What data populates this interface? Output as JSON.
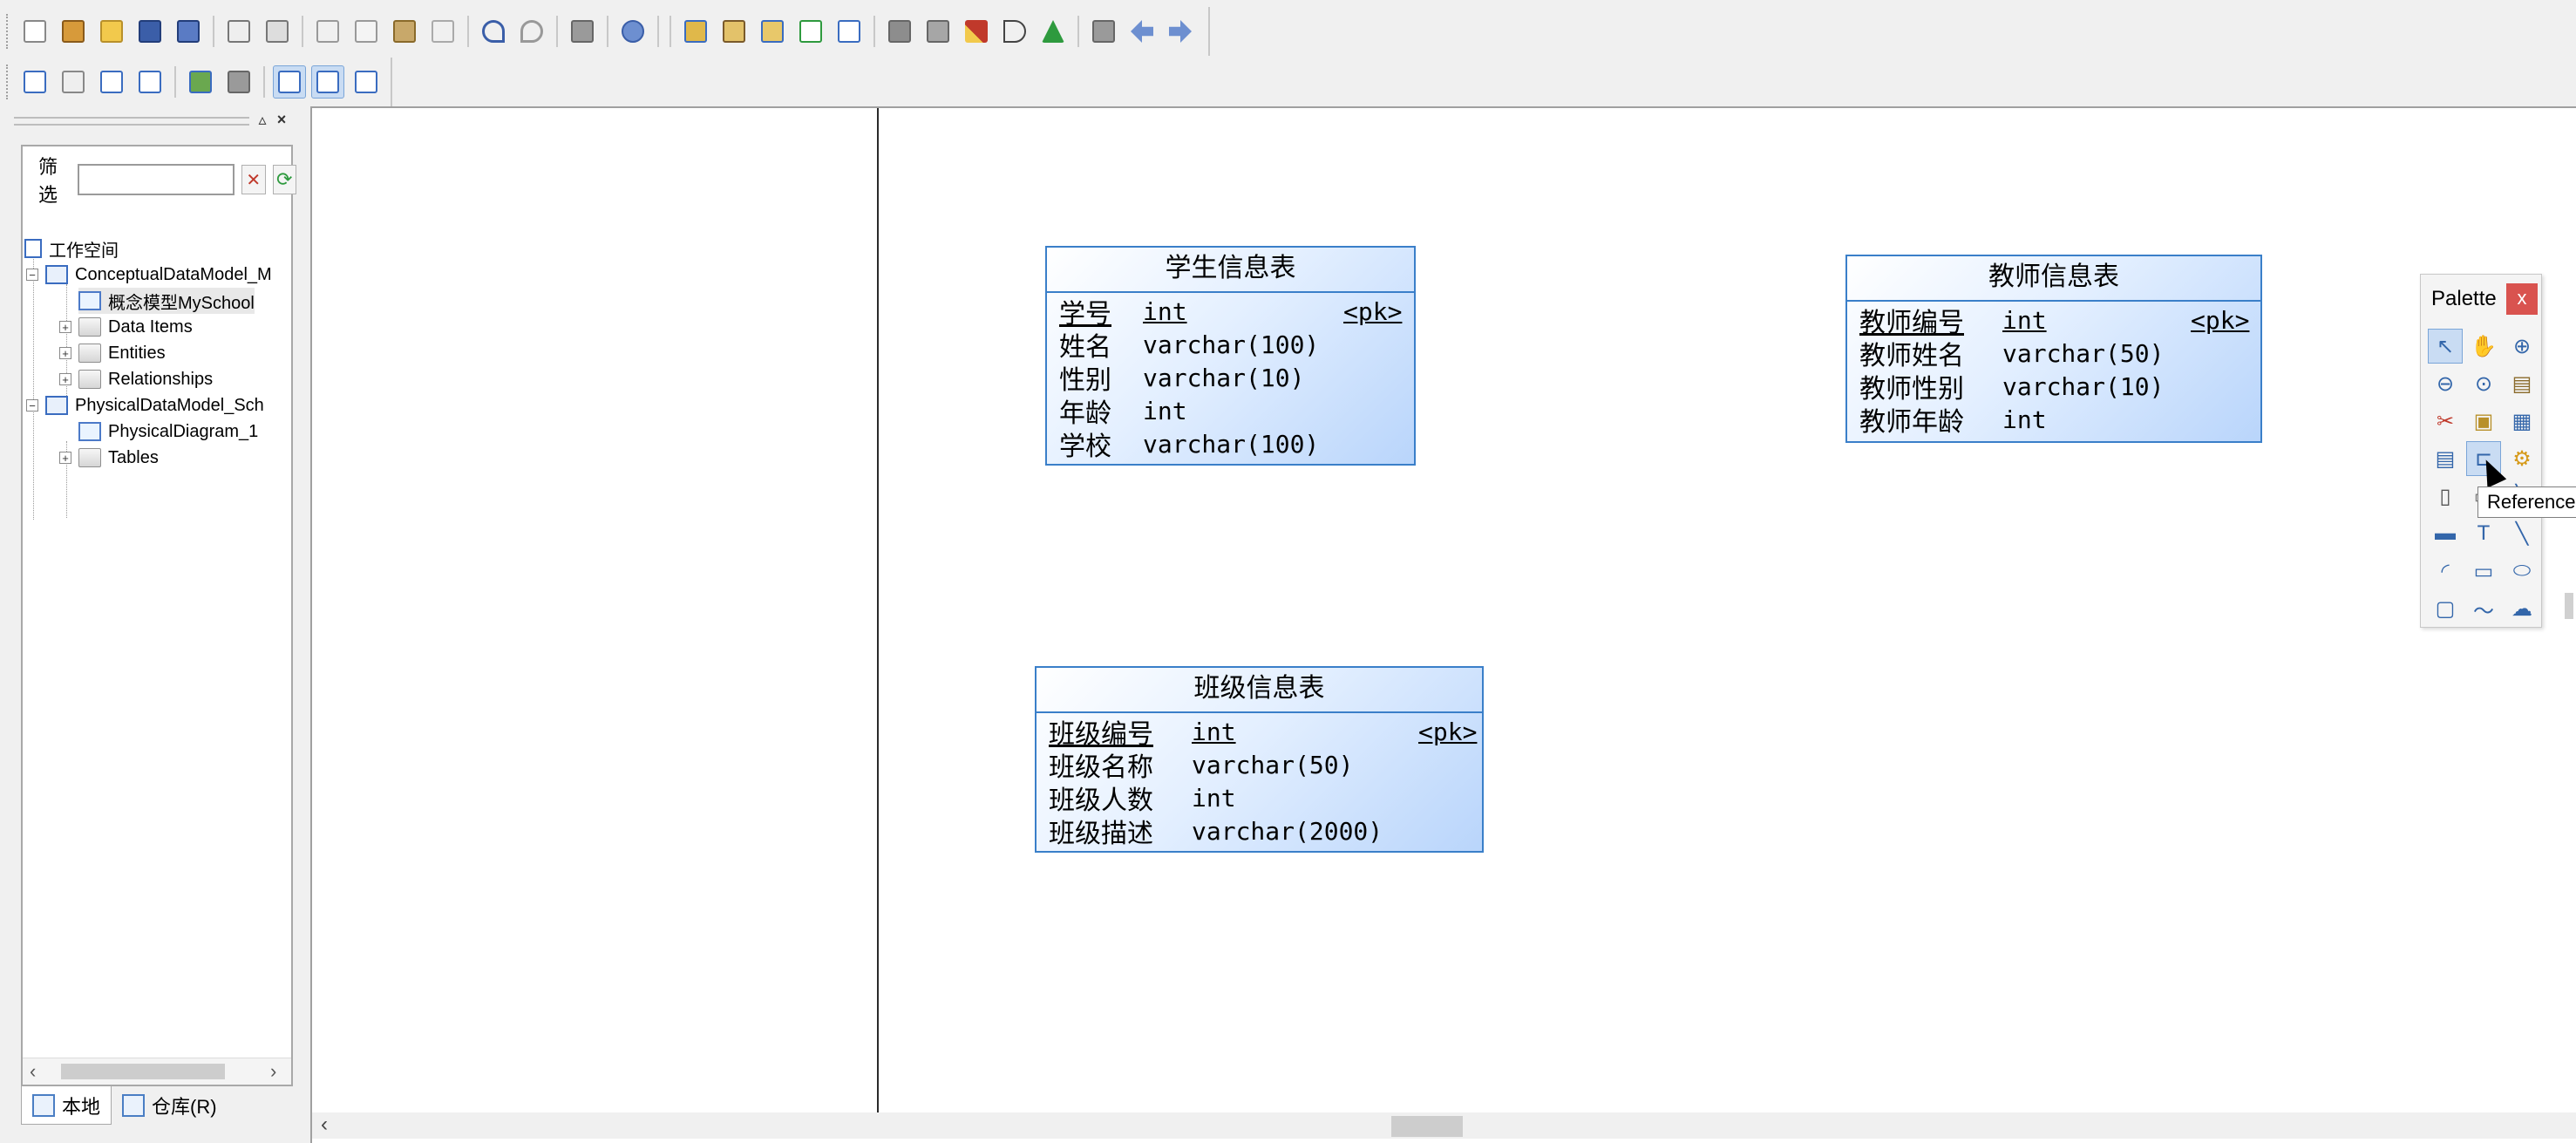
{
  "browser": {
    "filter_label": "筛选",
    "filter_value": "",
    "tree": {
      "workspace": "工作空间",
      "conceptual_model": "ConceptualDataModel_M",
      "conceptual_diagram": "概念模型MySchool",
      "data_items": "Data Items",
      "entities": "Entities",
      "relationships": "Relationships",
      "physical_model": "PhysicalDataModel_Sch",
      "physical_diagram": "PhysicalDiagram_1",
      "tables": "Tables"
    },
    "tabs": [
      {
        "label": "本地"
      },
      {
        "label": "仓库(R)"
      }
    ]
  },
  "entities": {
    "student": {
      "title": "学生信息表",
      "pk_marker": "<pk>",
      "attributes": [
        {
          "name": "学号",
          "type": "int"
        },
        {
          "name": "姓名",
          "type": "varchar(100)"
        },
        {
          "name": "性别",
          "type": "varchar(10)"
        },
        {
          "name": "年龄",
          "type": "int"
        },
        {
          "name": "学校",
          "type": "varchar(100)"
        }
      ]
    },
    "teacher": {
      "title": "教师信息表",
      "pk_marker": "<pk>",
      "attributes": [
        {
          "name": "教师编号",
          "type": "int"
        },
        {
          "name": "教师姓名",
          "type": "varchar(50)"
        },
        {
          "name": "教师性别",
          "type": "varchar(10)"
        },
        {
          "name": "教师年龄",
          "type": "int"
        }
      ]
    },
    "class": {
      "title": "班级信息表",
      "pk_marker": "<pk>",
      "attributes": [
        {
          "name": "班级编号",
          "type": "int"
        },
        {
          "name": "班级名称",
          "type": "varchar(50)"
        },
        {
          "name": "班级人数",
          "type": "int"
        },
        {
          "name": "班级描述",
          "type": "varchar(2000)"
        }
      ]
    }
  },
  "palette": {
    "title": "Palette",
    "close": "x",
    "tooltip": "Reference",
    "tools": [
      "pointer-icon",
      "grabber-icon",
      "zoom-in-icon",
      "zoom-out-icon",
      "zoom-area-icon",
      "open-diagram-icon",
      "delete-icon",
      "package-icon",
      "table-icon",
      "view-icon",
      "reference-icon",
      "procedure-icon",
      "file-icon",
      "note-icon",
      "line-icon",
      "title-icon",
      "text-icon",
      "arc-icon",
      "arc-shape-icon",
      "rectangle-icon",
      "ellipse-icon",
      "rounded-rect-icon",
      "polyline-icon",
      "freeform-icon"
    ]
  },
  "colors": {
    "entity_border": "#3a7fc9",
    "entity_fill_light": "#e3efff",
    "entity_fill_dark": "#b9d5fb",
    "selection": "#c9dcf3",
    "palette_close": "#d9534f"
  }
}
